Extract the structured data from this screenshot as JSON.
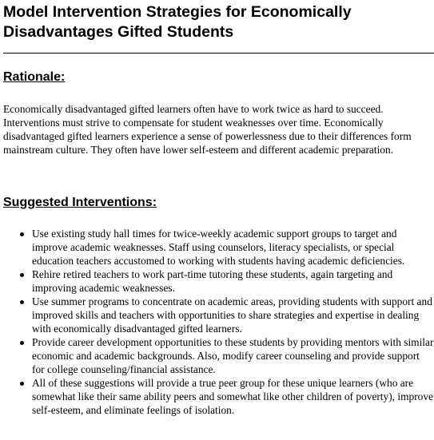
{
  "document": {
    "title": "Model Intervention Strategies for Economically Disadvantages Gifted Students"
  },
  "rationale": {
    "heading": "Rationale:",
    "paragraph": "Economically disadvantaged gifted learners often have to work twice as hard to succeed. Interventions must strive to compensate for student weaknesses over time. Economically disadvantaged gifted learners experience a sense of powerlessness due to their differences form mainstream culture. They often have lower self-esteem and different academic preparation."
  },
  "interventions": {
    "heading": "Suggested Interventions:",
    "items": [
      "Use existing study hall times for twice-weekly academic support groups to target and improve academic weaknesses. Staff using counselors, literacy specialists, or special education teachers accustomed to working with students having academic deficiencies.",
      "Rehire retired teachers to work part-time tutoring these students, again targeting and improving academic weaknesses.",
      "Use summer programs to concentrate on academic areas, providing students with support and improved skills and teachers with opportunities to share strategies and expertise in dealing with economically disadvantaged gifted learners.",
      "Provide career development opportunities to these students by providing mentors with similar economic and academic backgrounds. Also, modify career counseling and provide support for college counseling/financial assistance.",
      "All of these suggestions will provide a true peer group for these unique learners (who are somewhat like their same ability peers and somewhat like other children of poverty), improve self-esteem, and eliminate feelings of isolation."
    ]
  }
}
